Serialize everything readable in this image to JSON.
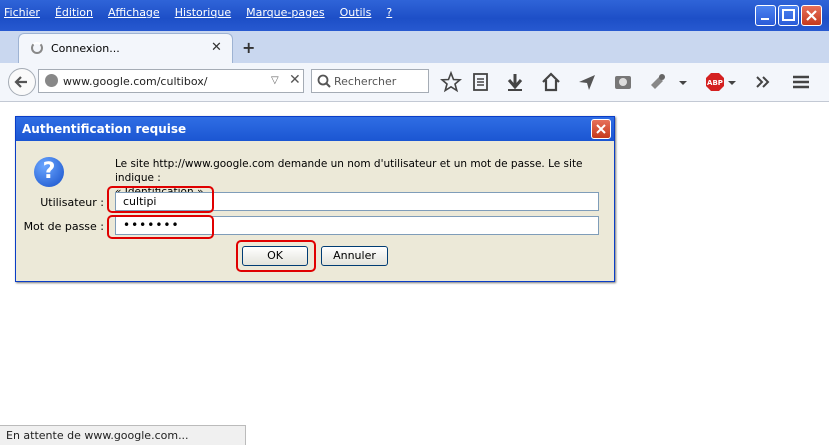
{
  "menu": [
    "Fichier",
    "Édition",
    "Affichage",
    "Historique",
    "Marque-pages",
    "Outils",
    "?"
  ],
  "tab": {
    "title": "Connexion..."
  },
  "url": {
    "value": "www.google.com/cultibox/"
  },
  "search": {
    "placeholder": "Rechercher"
  },
  "dialog": {
    "title": "Authentification requise",
    "message_line1": "Le site http://www.google.com demande un nom d'utilisateur et un mot de passe. Le site indique :",
    "message_line2": "« Identification »",
    "user_label": "Utilisateur :",
    "user_value": "cultipi",
    "pass_label": "Mot de passe :",
    "pass_value": "•••••••",
    "ok_label": "OK",
    "cancel_label": "Annuler"
  },
  "status": {
    "text": "En attente de www.google.com..."
  },
  "colors": {
    "highlight": "#e00000",
    "titlebar": "#1d4fc7",
    "dialog_bg": "#ece9d8"
  }
}
